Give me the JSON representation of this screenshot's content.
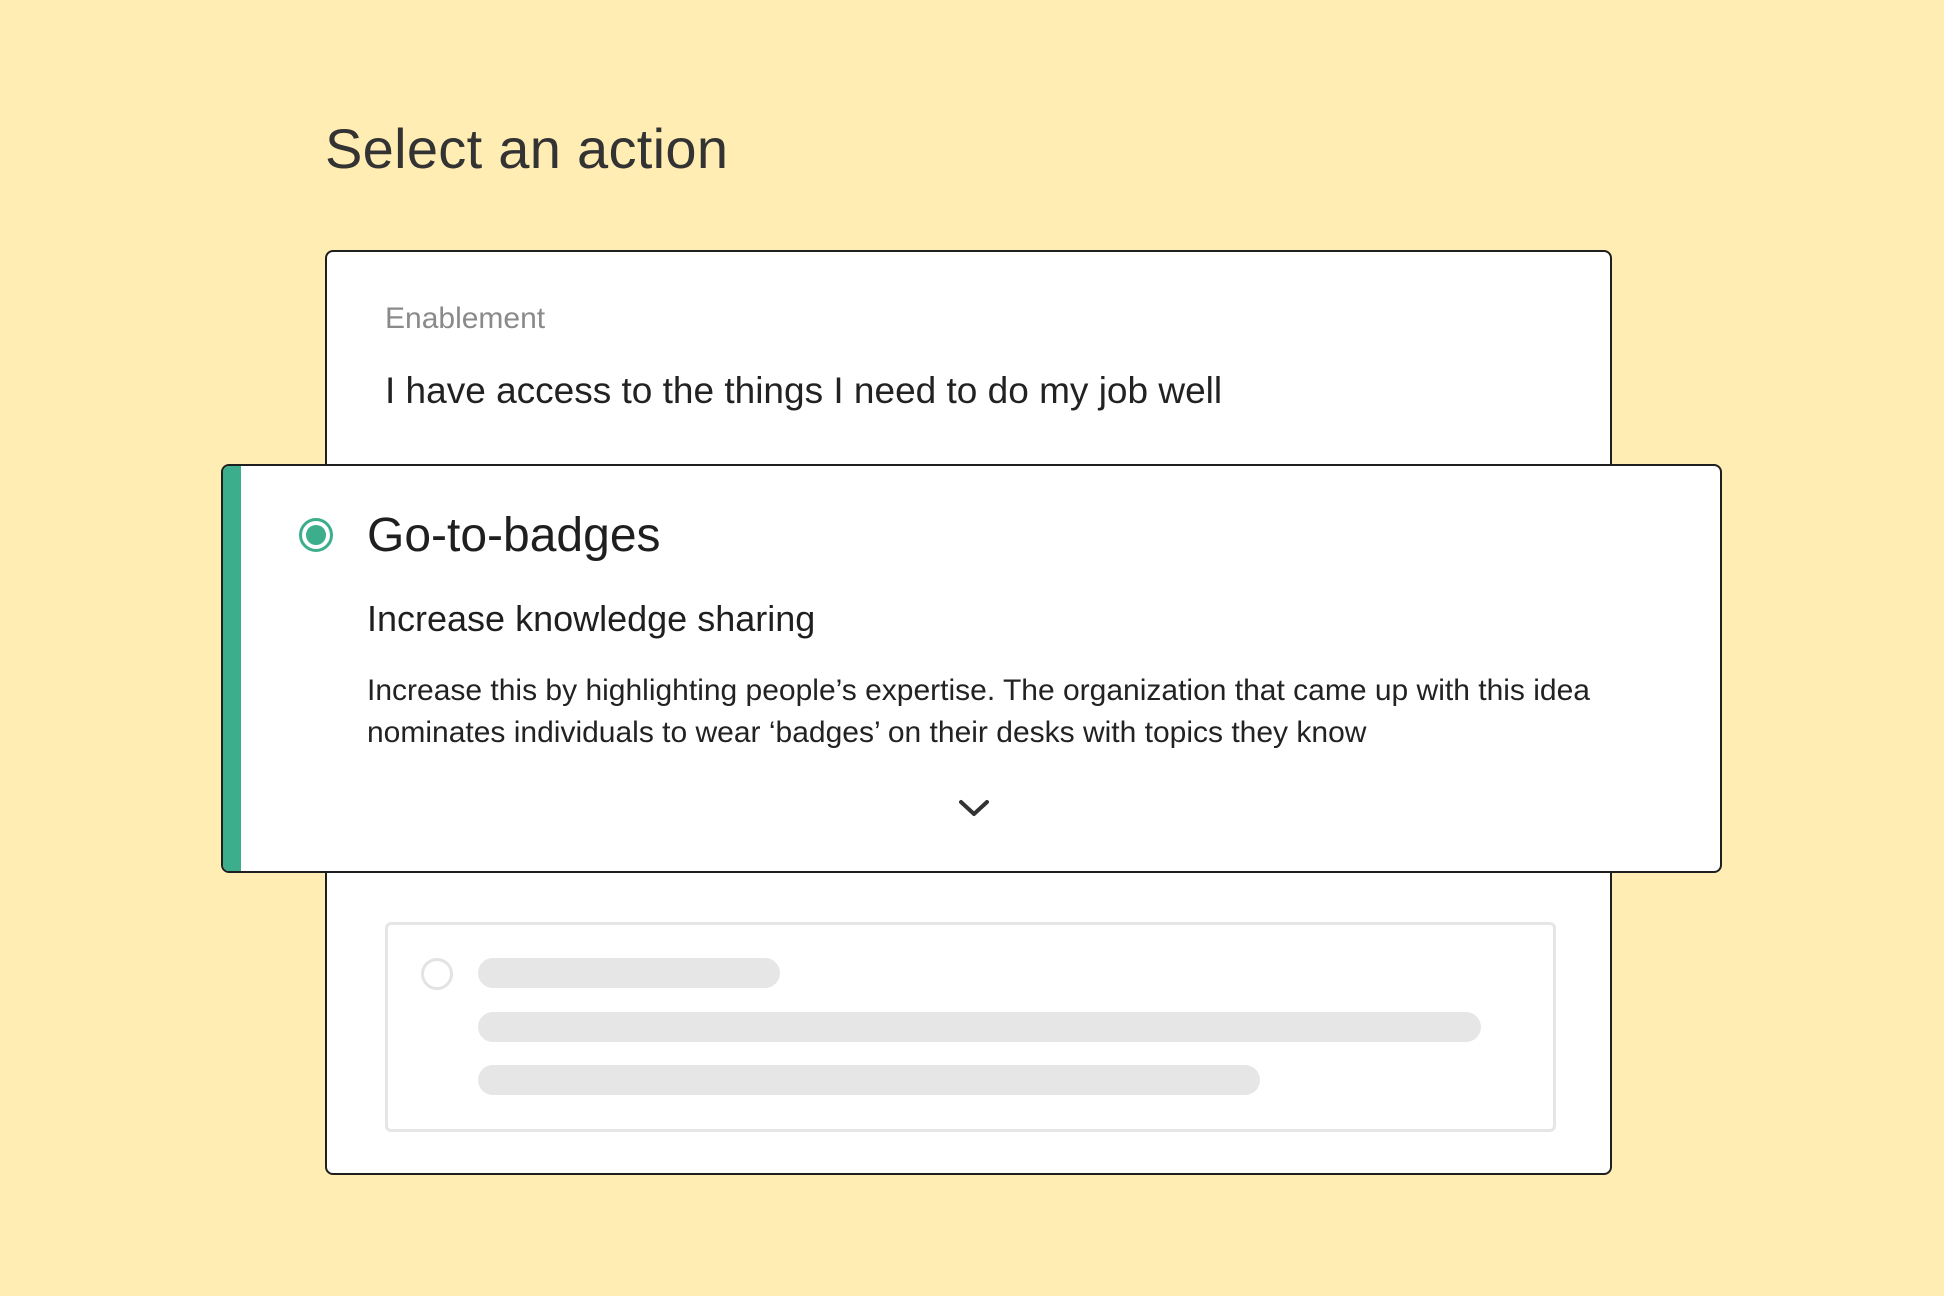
{
  "page": {
    "title": "Select an action"
  },
  "question": {
    "category": "Enablement",
    "statement": "I have access to the things I need to do my job well"
  },
  "selected_action": {
    "title": "Go-to-badges",
    "subtitle": "Increase knowledge sharing",
    "description": "Increase this by highlighting people’s expertise. The organization that came up with this idea nominates individuals to wear ‘badges’ on their desks with topics they know",
    "selected": true,
    "icons": {
      "radio": "radio-selected-icon",
      "expand": "chevron-down-icon"
    }
  },
  "colors": {
    "background": "#FFEDB3",
    "accent": "#3DAE8C",
    "border": "#1f1f1f",
    "placeholder": "#e6e6e6"
  }
}
